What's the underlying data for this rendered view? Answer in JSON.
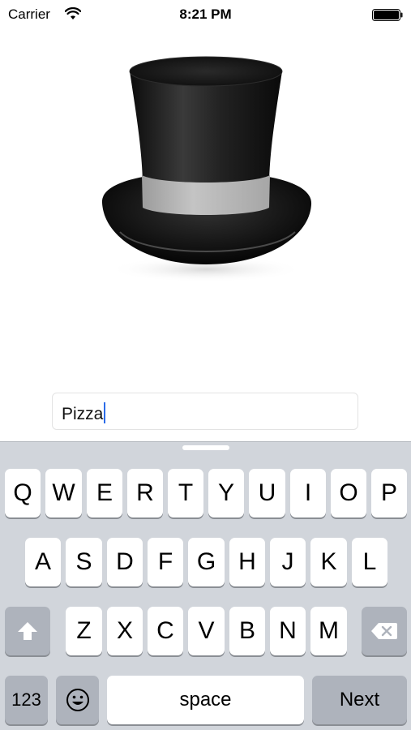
{
  "status_bar": {
    "carrier": "Carrier",
    "time": "8:21 PM"
  },
  "hat": {
    "icon": "top-hat-image",
    "band_color": "#b8b8b8",
    "hat_color": "#1a1a1a"
  },
  "text_field": {
    "value": "Pizza"
  },
  "keyboard": {
    "row1": [
      "Q",
      "W",
      "E",
      "R",
      "T",
      "Y",
      "U",
      "I",
      "O",
      "P"
    ],
    "row2": [
      "A",
      "S",
      "D",
      "F",
      "G",
      "H",
      "J",
      "K",
      "L"
    ],
    "row3": [
      "Z",
      "X",
      "C",
      "V",
      "B",
      "N",
      "M"
    ],
    "numbers_label": "123",
    "space_label": "space",
    "next_label": "Next",
    "shift_icon": "shift-icon",
    "delete_icon": "delete-icon",
    "emoji_icon": "emoji-icon"
  }
}
